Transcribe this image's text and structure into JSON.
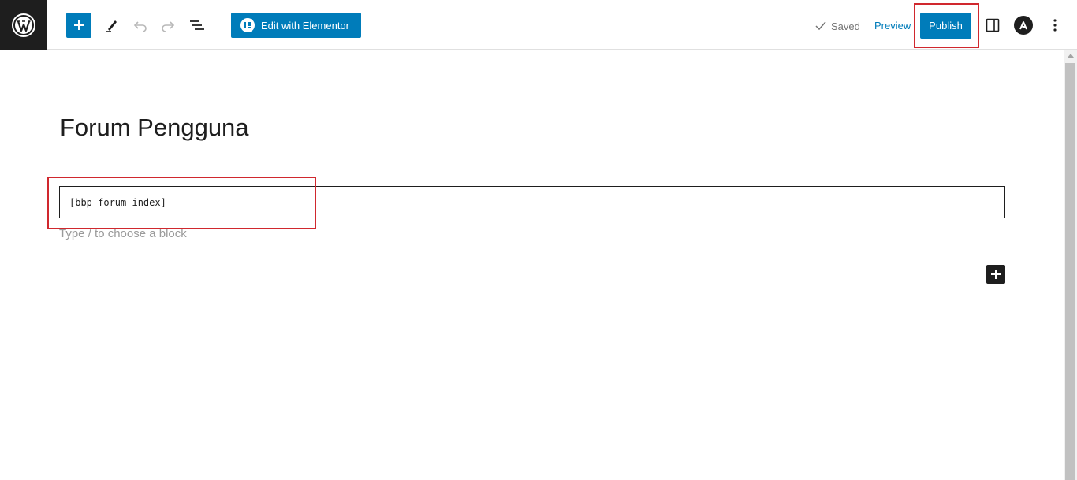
{
  "toolbar": {
    "logo_icon": "wordpress-icon",
    "add_icon": "plus-icon",
    "tools_icon": "pen-icon",
    "undo_icon": "undo-icon",
    "redo_icon": "redo-icon",
    "outline_icon": "list-view-icon",
    "elementor_label": "Edit with Elementor",
    "saved_label": "Saved",
    "preview_label": "Preview",
    "publish_label": "Publish",
    "settings_icon": "sidebar-toggle-icon",
    "astra_icon": "astra-icon",
    "more_icon": "vertical-ellipsis-icon"
  },
  "editor": {
    "title": "Forum Pengguna",
    "shortcode": "[bbp-forum-index]",
    "placeholder": "Type / to choose a block"
  },
  "colors": {
    "accent": "#007cba",
    "dark": "#1e1e1e",
    "highlight": "#d0282e"
  }
}
